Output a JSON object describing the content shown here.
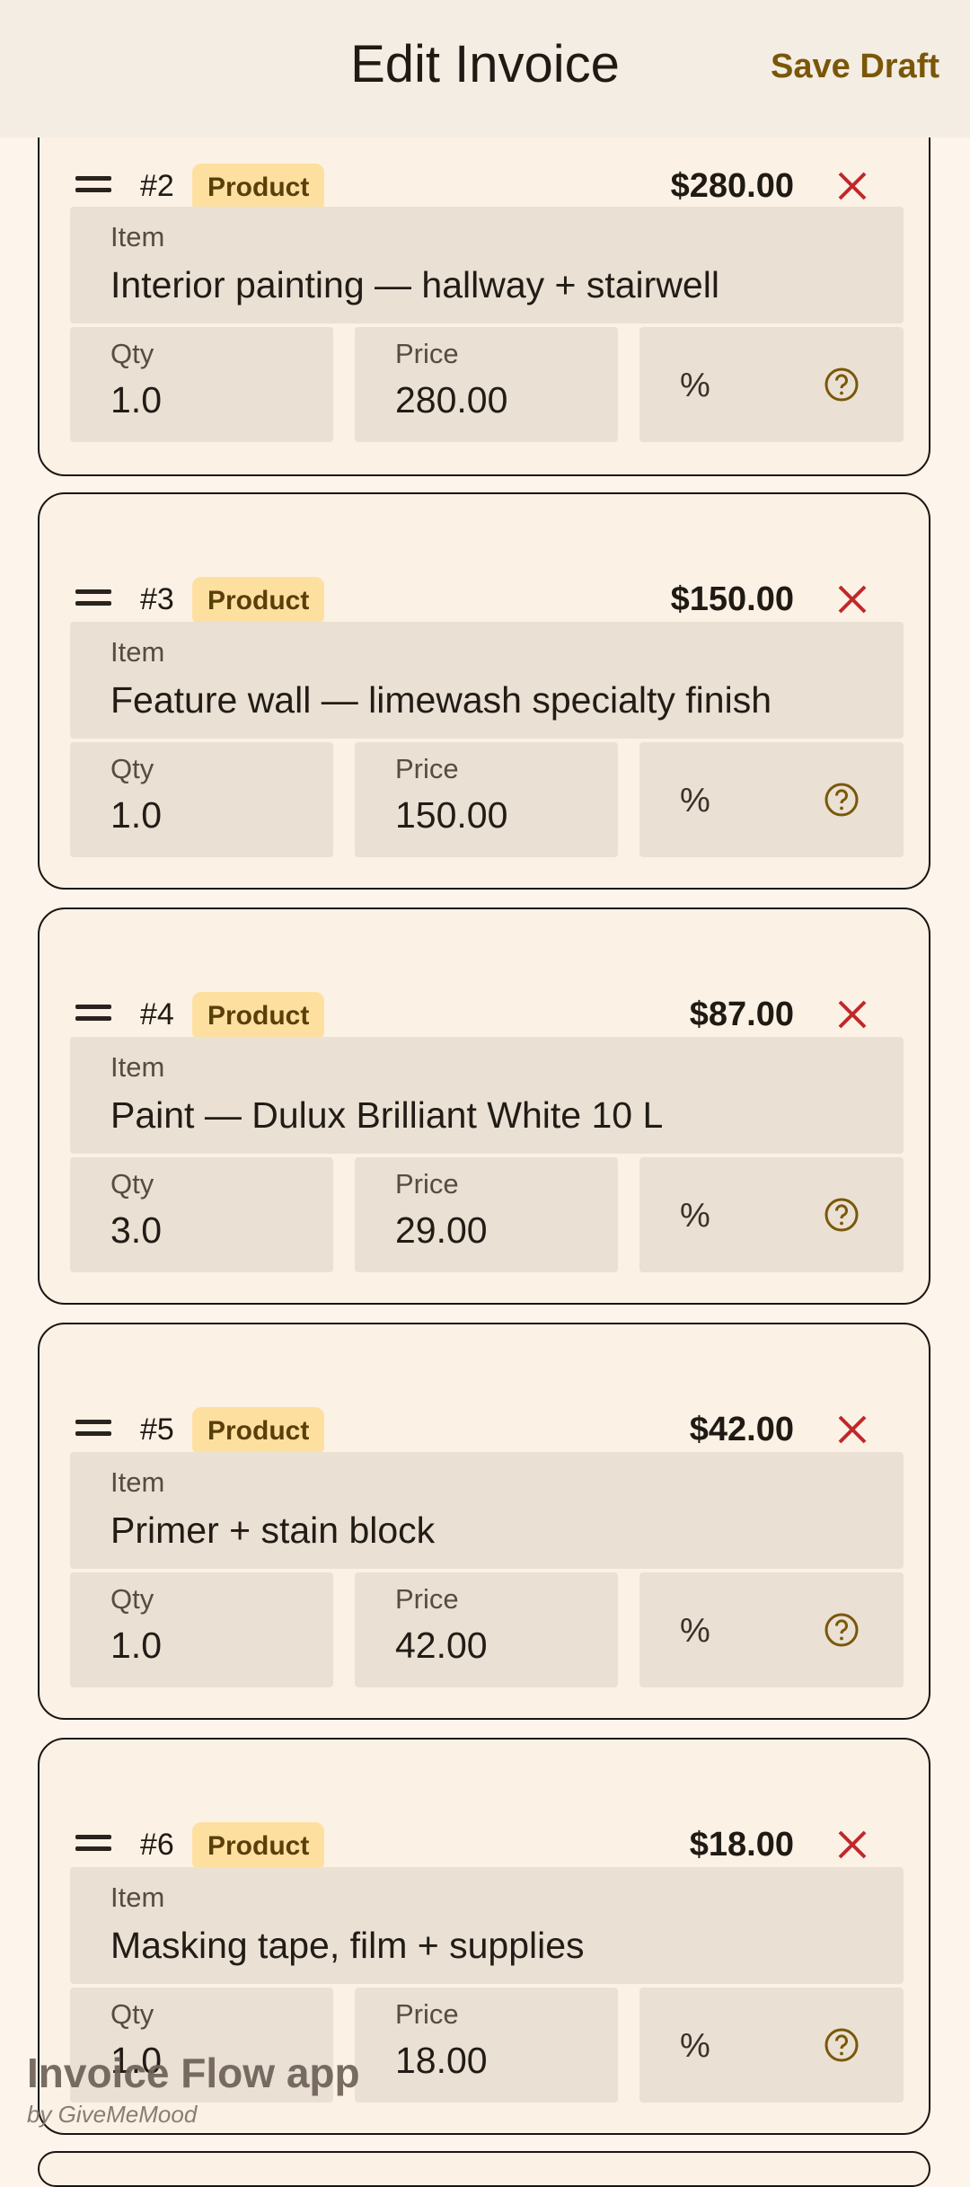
{
  "appbar": {
    "title": "Edit Invoice",
    "save_label": "Save Draft"
  },
  "items": [
    {
      "number": "#2",
      "badge": "Product",
      "amount": "$280.00",
      "item_label": "Item",
      "item_value": "Interior painting — hallway + stairwell",
      "qty_label": "Qty",
      "qty_value": "1.0",
      "price_label": "Price",
      "price_value": "280.00",
      "percent": "%"
    },
    {
      "number": "#3",
      "badge": "Product",
      "amount": "$150.00",
      "item_label": "Item",
      "item_value": "Feature wall — limewash specialty finish",
      "qty_label": "Qty",
      "qty_value": "1.0",
      "price_label": "Price",
      "price_value": "150.00",
      "percent": "%"
    },
    {
      "number": "#4",
      "badge": "Product",
      "amount": "$87.00",
      "item_label": "Item",
      "item_value": "Paint — Dulux Brilliant White 10 L",
      "qty_label": "Qty",
      "qty_value": "3.0",
      "price_label": "Price",
      "price_value": "29.00",
      "percent": "%"
    },
    {
      "number": "#5",
      "badge": "Product",
      "amount": "$42.00",
      "item_label": "Item",
      "item_value": "Primer + stain block",
      "qty_label": "Qty",
      "qty_value": "1.0",
      "price_label": "Price",
      "price_value": "42.00",
      "percent": "%"
    },
    {
      "number": "#6",
      "badge": "Product",
      "amount": "$18.00",
      "item_label": "Item",
      "item_value": "Masking tape, film + supplies",
      "qty_label": "Qty",
      "qty_value": "1.0",
      "price_label": "Price",
      "price_value": "18.00",
      "percent": "%"
    }
  ],
  "watermark": {
    "title": "Invoice Flow app",
    "subtitle": "by GiveMeMood"
  },
  "colors": {
    "background": "#fdf4ec",
    "appbar": "#f4ede3",
    "accent": "#7a5708",
    "remove": "#c0282a",
    "badge": "#fde0a0",
    "field": "#eae0d4"
  },
  "icons": {
    "drag": "drag-handle-icon",
    "remove": "close-icon",
    "help": "help-circle-icon"
  }
}
